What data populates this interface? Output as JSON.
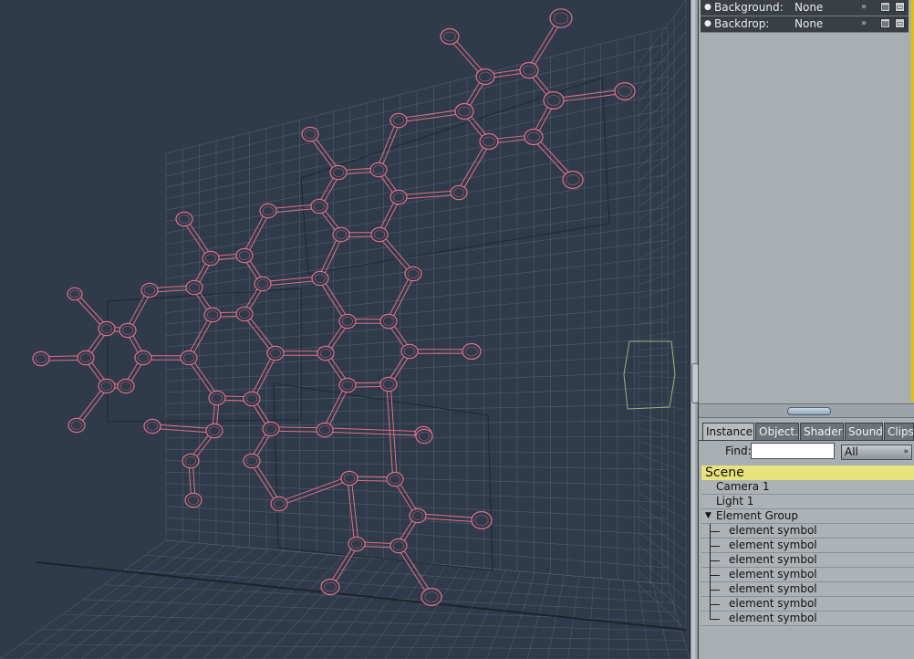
{
  "properties": [
    {
      "label": "Background:",
      "value": "None"
    },
    {
      "label": "Backdrop:",
      "value": "None"
    }
  ],
  "tabs": [
    "Instance.",
    "Object.",
    "Shader.",
    "Sound.",
    "Clips"
  ],
  "active_tab": "Instance.",
  "find": {
    "label": "Find:",
    "value": "",
    "filter": "All"
  },
  "tree": {
    "header": "Scene",
    "items": [
      {
        "label": "Camera 1",
        "level": 0
      },
      {
        "label": "Light 1",
        "level": 0
      },
      {
        "label": "Element Group",
        "level": 0,
        "expanded": true
      },
      {
        "label": "element symbol",
        "level": 1
      },
      {
        "label": "element symbol",
        "level": 1
      },
      {
        "label": "element symbol",
        "level": 1
      },
      {
        "label": "element symbol",
        "level": 1
      },
      {
        "label": "element symbol",
        "level": 1
      },
      {
        "label": "element symbol",
        "level": 1
      },
      {
        "label": "element symbol",
        "level": 1
      }
    ]
  },
  "colors": {
    "viewport_background": "#2f3a4a",
    "grid": "#6b7788",
    "molecule_wireframe": "#e07088",
    "scene_header": "#e8e27d",
    "panel": "#a9aeb3"
  },
  "icons": [
    "dropdown-arrow-icon",
    "save-icon",
    "folder-icon",
    "expand-triangle-icon",
    "splitter-grip-icon"
  ]
}
